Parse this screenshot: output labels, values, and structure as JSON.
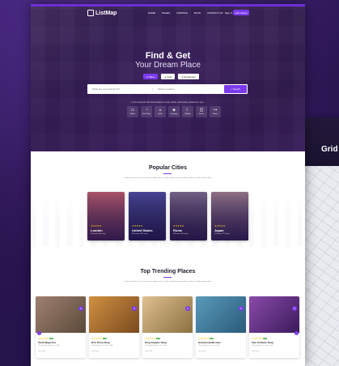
{
  "colors": {
    "accent": "#7c3aed",
    "hero_overlay": "#3b1570",
    "star": "#f5c518"
  },
  "side_page": {
    "title": "Grid M",
    "subtitle": ""
  },
  "nav": {
    "logo": "ListMap",
    "links": [
      "HOME",
      "PAGES",
      "LISTINGS",
      "BLOG",
      "CONTACT US"
    ],
    "sign_in": "Sign In",
    "cta": "Add Listing"
  },
  "hero": {
    "title": "Find & Get",
    "subtitle": "Your Dream Place",
    "tabs": [
      {
        "label": "Place",
        "icon": "pin-icon"
      },
      {
        "label": "Cafe",
        "icon": "cup-icon"
      },
      {
        "label": "Restaurant",
        "icon": "fork-icon"
      }
    ],
    "search_what_placeholder": "What are you looking for?",
    "search_where_placeholder": "Select Location",
    "search_button": "Search",
    "hint": "Let's uncover the best places to eat, drink, and shop nearest to you.",
    "categories": [
      {
        "label": "Hotels",
        "icon": "bed-icon"
      },
      {
        "label": "Eat & Drink",
        "icon": "cup-icon"
      },
      {
        "label": "Coffee",
        "icon": "coffee-icon"
      },
      {
        "label": "Shopping",
        "icon": "bag-icon"
      },
      {
        "label": "Nightlife",
        "icon": "moon-icon"
      },
      {
        "label": "Events",
        "icon": "ticket-icon"
      },
      {
        "label": "Fitness",
        "icon": "dumbbell-icon"
      }
    ]
  },
  "popular": {
    "title": "Popular Cities",
    "desc": "Lorem ipsum dolor sit amet, consectetur adipiscing elit, sed do eiusmod tempor incididunt ut labore et dolore magna aliqua.",
    "cities": [
      {
        "name": "London",
        "meta": "4 Reviews  89 Listing",
        "stars": "★★★★★",
        "bg": "#9a4a5a"
      },
      {
        "name": "United States",
        "meta": "6 Reviews  120 Listing",
        "stars": "★★★★★",
        "bg": "#3a3a7a"
      },
      {
        "name": "Rome",
        "meta": "3 Reviews  45 Listing",
        "stars": "★★★★★",
        "bg": "#5a4a6a"
      },
      {
        "name": "Japan",
        "meta": "5 Reviews  77 Listing",
        "stars": "★★★★★",
        "bg": "#7a5a6a"
      }
    ]
  },
  "trending": {
    "title": "Top Trending Places",
    "desc": "Lorem ipsum dolor sit amet, consectetur adipiscing elit, sed do eiusmod tempor incididunt ut labore et dolore magna aliqua.",
    "places": [
      {
        "name": "Verdi Mega Zoo",
        "addr": "27th Brooklyn New York, USA",
        "score": "4.5",
        "foot": "Open Now",
        "bg": "#8a6a5a"
      },
      {
        "name": "NYC Pizza Shop",
        "addr": "27th Brooklyn New York, USA",
        "score": "4.2",
        "foot": "Open Now",
        "bg": "#b8762a"
      },
      {
        "name": "King Organic Shop",
        "addr": "27th Brooklyn New York, USA",
        "score": "4.8",
        "foot": "Open Now",
        "bg": "#caa56a"
      },
      {
        "name": "Grande Health Care",
        "addr": "27th Brooklyn New York, USA",
        "score": "4.6",
        "foot": "Open Now",
        "bg": "#4a7a9a"
      },
      {
        "name": "Tam Softume Shop",
        "addr": "27th Brooklyn New York, USA",
        "score": "4.3",
        "foot": "Open Now",
        "bg": "#6a3a8a"
      }
    ]
  }
}
